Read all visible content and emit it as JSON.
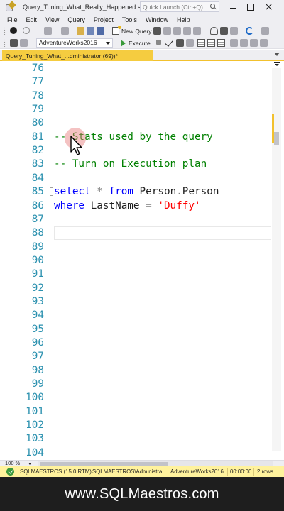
{
  "window": {
    "title": "Query_Tuning_What_Really_Happened.sql -...",
    "quick_launch_placeholder": "Quick Launch (Ctrl+Q)"
  },
  "menu": [
    "File",
    "Edit",
    "View",
    "Query",
    "Project",
    "Tools",
    "Window",
    "Help"
  ],
  "toolbar": {
    "new_query_label": "New Query",
    "database": "AdventureWorks2016",
    "execute_label": "Execute"
  },
  "tab": {
    "label": "Query_Tuning_What_...dministrator (69))*"
  },
  "editor": {
    "lines": [
      {
        "num": "76",
        "tokens": []
      },
      {
        "num": "77",
        "tokens": []
      },
      {
        "num": "78",
        "tokens": []
      },
      {
        "num": "79",
        "tokens": []
      },
      {
        "num": "80",
        "tokens": []
      },
      {
        "num": "81",
        "tokens": [
          {
            "t": "-- Stats used by the query",
            "c": "cm"
          }
        ]
      },
      {
        "num": "82",
        "tokens": []
      },
      {
        "num": "83",
        "tokens": [
          {
            "t": "-- Turn on Execution plan",
            "c": "cm"
          }
        ]
      },
      {
        "num": "84",
        "tokens": []
      },
      {
        "num": "85",
        "tokens": [
          {
            "t": "select",
            "c": "kw"
          },
          {
            "t": " ",
            "c": "id"
          },
          {
            "t": "*",
            "c": "op"
          },
          {
            "t": " ",
            "c": "id"
          },
          {
            "t": "from",
            "c": "kw"
          },
          {
            "t": " Person",
            "c": "id"
          },
          {
            "t": ".",
            "c": "op"
          },
          {
            "t": "Person",
            "c": "id"
          }
        ]
      },
      {
        "num": "86",
        "tokens": [
          {
            "t": "where",
            "c": "kw"
          },
          {
            "t": " LastName ",
            "c": "id"
          },
          {
            "t": "=",
            "c": "op"
          },
          {
            "t": " ",
            "c": "id"
          },
          {
            "t": "'Duffy'",
            "c": "str"
          }
        ]
      },
      {
        "num": "87",
        "tokens": []
      },
      {
        "num": "88",
        "tokens": []
      },
      {
        "num": "89",
        "tokens": []
      },
      {
        "num": "90",
        "tokens": []
      },
      {
        "num": "91",
        "tokens": []
      },
      {
        "num": "92",
        "tokens": []
      },
      {
        "num": "93",
        "tokens": []
      },
      {
        "num": "94",
        "tokens": []
      },
      {
        "num": "95",
        "tokens": []
      },
      {
        "num": "96",
        "tokens": []
      },
      {
        "num": "97",
        "tokens": []
      },
      {
        "num": "98",
        "tokens": []
      },
      {
        "num": "99",
        "tokens": []
      },
      {
        "num": "100",
        "tokens": []
      },
      {
        "num": "101",
        "tokens": []
      },
      {
        "num": "102",
        "tokens": []
      },
      {
        "num": "103",
        "tokens": []
      },
      {
        "num": "104",
        "tokens": []
      }
    ]
  },
  "zoom": "100 %",
  "status": {
    "server": "SQLMAESTROS (15.0 RTM)",
    "user": "SQLMAESTROS\\Administra...",
    "database": "AdventureWorks2016",
    "elapsed": "00:00:00",
    "rows": "2 rows"
  },
  "footer": {
    "text": "www.SQLMaestros.com"
  },
  "colors": {
    "keyword": "#0000ff",
    "comment": "#008000",
    "string": "#ff0000",
    "line_number": "#2b91af",
    "tab_accent": "#f5cc40",
    "status_bar": "#fff29d"
  }
}
